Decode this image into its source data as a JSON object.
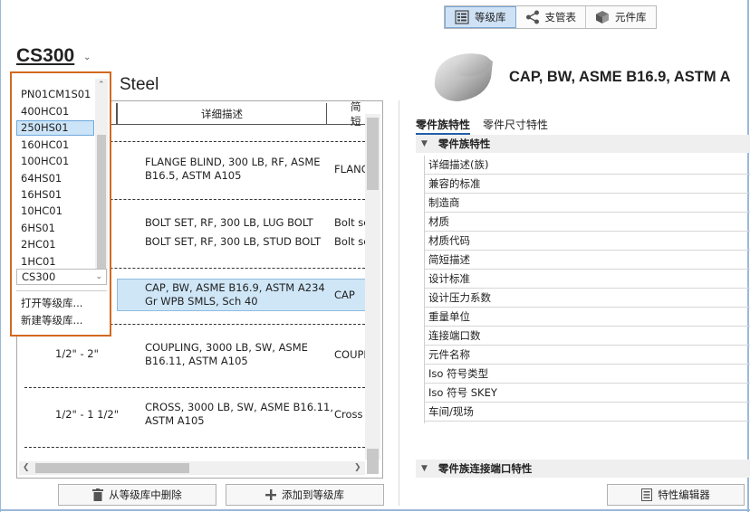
{
  "toolbar": {
    "items": [
      {
        "label": "等级库",
        "icon": "spec-list-icon",
        "active": true
      },
      {
        "label": "支管表",
        "icon": "branch-table-icon",
        "active": false
      },
      {
        "label": "元件库",
        "icon": "catalog-cube-icon",
        "active": false
      }
    ]
  },
  "spec": {
    "name": "CS300",
    "subtitle": "Steel"
  },
  "table": {
    "headers": [
      "详细描述",
      "简短"
    ],
    "rows": [
      {
        "size": "",
        "desc1": "FLANGE BLIND, 300 LB, RF, ASME",
        "desc2": "B16.5, ASTM A105",
        "short": "FLANG"
      },
      {
        "size": "",
        "desc1": "BOLT SET, RF, 300 LB, LUG BOLT",
        "desc2": "",
        "short": "Bolt se"
      },
      {
        "size": "",
        "desc1": "BOLT SET, RF, 300 LB, STUD BOLT",
        "desc2": "",
        "short": "Bolt se"
      },
      {
        "size": "",
        "desc1": "CAP, BW, ASME B16.9, ASTM A234",
        "desc2": "Gr WPB SMLS, Sch 40",
        "short": "CAP"
      },
      {
        "size": "1/2\" - 2\"",
        "desc1": "COUPLING, 3000 LB, SW, ASME",
        "desc2": "B16.11, ASTM A105",
        "short": "COUPL"
      },
      {
        "size": "1/2\" - 1 1/2\"",
        "desc1": "CROSS, 3000 LB, SW, ASME B16.11,",
        "desc2": "ASTM A105",
        "short": "Cross"
      }
    ]
  },
  "dropdown": {
    "options": [
      "PN01CM1S01",
      "400HC01",
      "250HS01",
      "160HC01",
      "100HC01",
      "64HS01",
      "16HS01",
      "10HC01",
      "6HS01",
      "2HC01",
      "1HC01"
    ],
    "selected": "250HS01",
    "current": "CS300",
    "open_label": "打开等级库...",
    "new_label": "新建等级库..."
  },
  "buttons": {
    "delete_label": "从等级库中删除",
    "add_label": "添加到等级库",
    "editor_label": "特性编辑器"
  },
  "detail": {
    "title": "CAP, BW, ASME B16.9, ASTM A",
    "tabs": [
      "零件族特性",
      "零件尺寸特性"
    ],
    "section1": "零件族特性",
    "section2": "零件族连接端口特性",
    "properties": [
      "详细描述(族)",
      "兼容的标准",
      "制造商",
      "材质",
      "材质代码",
      "简短描述",
      "设计标准",
      "设计压力系数",
      "重量单位",
      "连接端口数",
      "元件名称",
      "Iso 符号类型",
      "Iso 符号 SKEY",
      "车间/现场"
    ]
  }
}
